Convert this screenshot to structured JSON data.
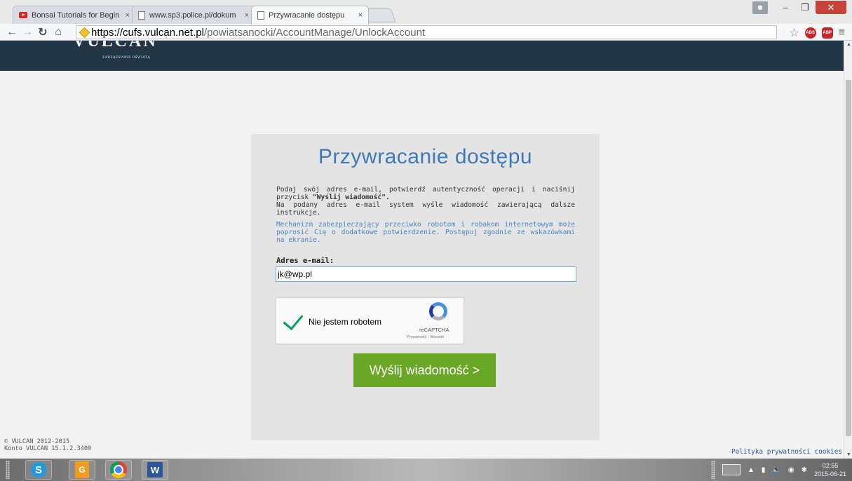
{
  "browser": {
    "tabs": [
      {
        "title": "Bonsai Tutorials for Begin",
        "icon": "youtube-icon"
      },
      {
        "title": "www.sp3.police.pl/dokum",
        "icon": "document-icon"
      },
      {
        "title": "Przywracanie dostępu",
        "icon": "document-icon",
        "active": true
      }
    ],
    "tab_close": "×",
    "url_host": "https://cufs.vulcan.net.pl",
    "url_path": "/powiatsanocki/AccountManage/UnlockAccount",
    "extensions": [
      "ABS",
      "ABP"
    ]
  },
  "header": {
    "logo": "VULCAN",
    "logo_sub": "ZARZĄDZANIE OŚWIATĄ"
  },
  "form": {
    "title": "Przywracanie dostępu",
    "desc_line1": "Podaj swój adres e-mail, potwierdź autentyczność operacji i naciśnij przycisk",
    "desc_bold": "\"Wyślij wiadomość\".",
    "desc_line2": "Na podany adres e-mail system wyśle wiadomość zawierającą dalsze instrukcje.",
    "note": "Mechanizm zabezpieczający przeciwko robotom i robakom internetowym może poprosić Cię o dodatkowe potwierdzenie. Postępuj zgodnie ze wskazówkami na ekranie.",
    "email_label": "Adres e-mail:",
    "email_value": "jk@wp.pl",
    "captcha_label": "Nie jestem robotem",
    "captcha_brand": "reCAPTCHA",
    "captcha_terms": "Prywatność - Warunki",
    "captcha_checked": true,
    "submit_label": "Wyślij wiadomość >"
  },
  "footer": {
    "copyright": "© VULCAN 2012-2015",
    "version": "Konto VULCAN 15.1.2.3409",
    "privacy_link": "Polityka prywatności cookies"
  },
  "taskbar": {
    "apps": [
      "skype-icon",
      "pdf-creator-icon",
      "chrome-icon",
      "word-icon"
    ],
    "time": "02:55",
    "date": "2015-06-21"
  },
  "colors": {
    "header_bg": "#233648",
    "title_blue": "#3d7ab8",
    "submit_green": "#6aa727",
    "card_bg": "#e4e4e4"
  }
}
